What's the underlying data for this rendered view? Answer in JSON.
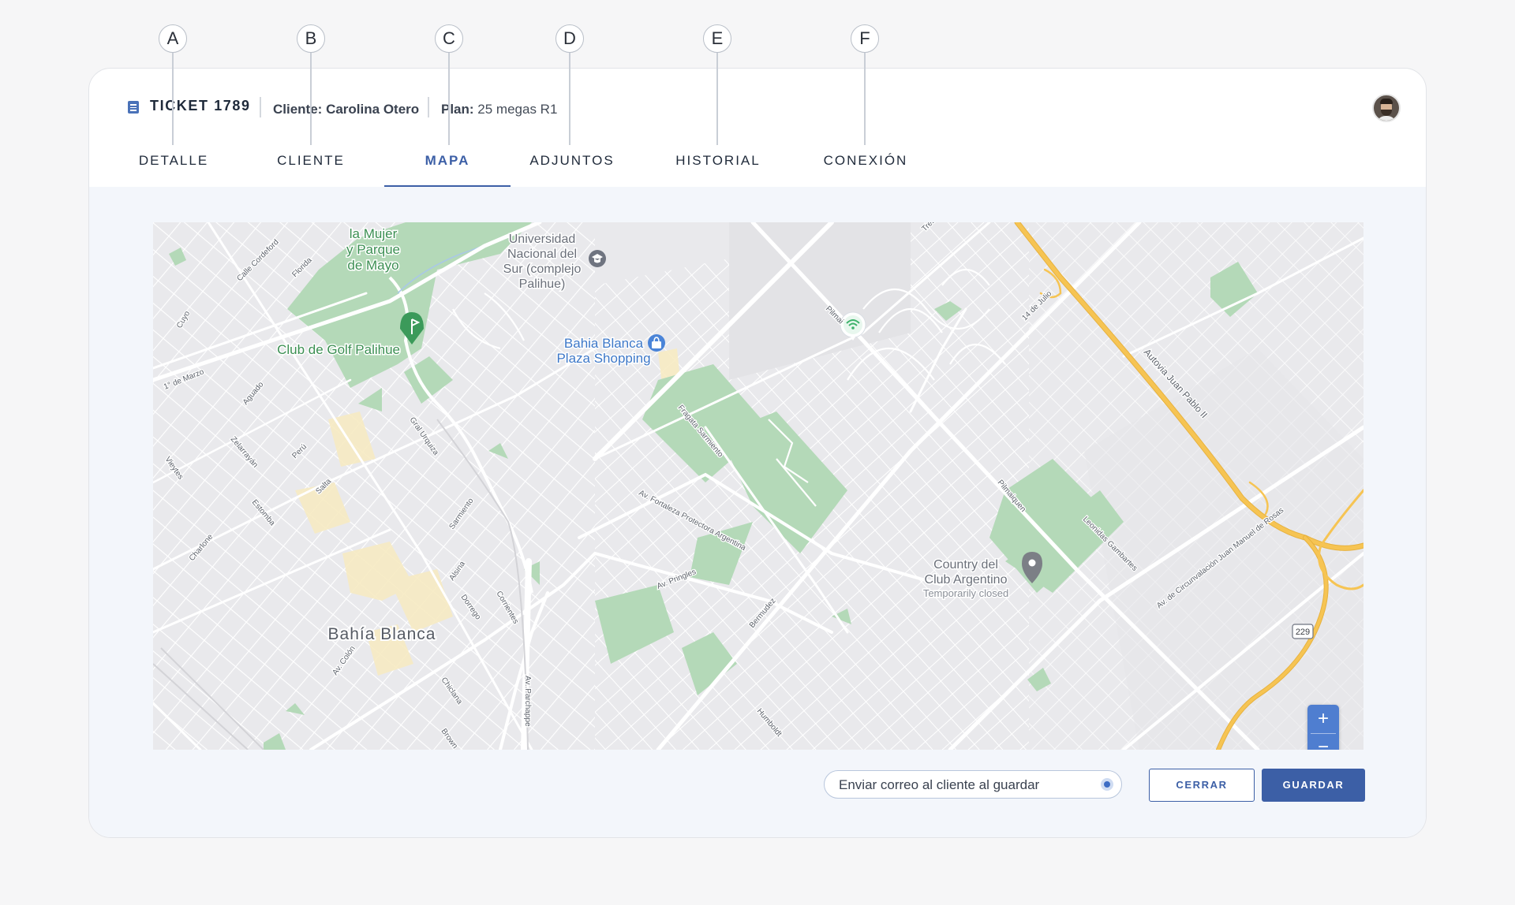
{
  "callouts": [
    "A",
    "B",
    "C",
    "D",
    "E",
    "F"
  ],
  "header": {
    "ticket_title": "TICKET 1789",
    "client_label": "Cliente:",
    "client_value": "Carolina Otero",
    "plan_label": "Plan:",
    "plan_value": "25 megas R1"
  },
  "tabs": [
    {
      "label": "DETALLE"
    },
    {
      "label": "CLIENTE"
    },
    {
      "label": "MAPA",
      "active": true
    },
    {
      "label": "ADJUNTOS"
    },
    {
      "label": "HISTORIAL"
    },
    {
      "label": "CONEXIÓN"
    }
  ],
  "map": {
    "places": {
      "plaza_mayo": [
        "la Mujer",
        "y Parque",
        "de Mayo"
      ],
      "universidad": [
        "Universidad",
        "Nacional del",
        "Sur (complejo",
        "Palihue)"
      ],
      "golf": "Club de Golf Palihue",
      "shopping": [
        "Bahia Blanca",
        "Plaza Shopping"
      ],
      "city": "Bahía Blanca",
      "country": [
        "Country del",
        "Club Argentino"
      ],
      "country_status": "Temporarily closed",
      "route_shield": "229"
    },
    "streets": {
      "calle_cordeford": "Calle Cordeford",
      "florida": "Florida",
      "cuyo": "Cuyo",
      "primero_marzo": "1° de Marzo",
      "aguado": "Aguado",
      "zelarrayan": "Zelarrayán",
      "peru": "Perú",
      "vieytes": "Vieytes",
      "salta": "Salta",
      "estomba": "Estomba",
      "chiclana_upper": "Charlone",
      "uriburu": "Gral Urquiza",
      "sarmiento": "Sarmiento",
      "alsina": "Alsina",
      "dorrego": "Dorrego",
      "corrientes": "Corrientes",
      "colon": "Av. Colón",
      "chiclana": "Chiclana",
      "brown": "Brown",
      "parchappe": "Av. Parchappe",
      "fragata": "Fragata Sarmiento",
      "fortaleza": "Av. Fortaleza Protectora Argentina",
      "pringles": "Av. Pringles",
      "bermudez": "Bermudez",
      "humboldt": "Humboldt",
      "pilmaiquen_top": "Pilmai",
      "pilmaiquen": "Pilmaiquen",
      "tres": "Tres",
      "catorce_julio": "14 de Julio",
      "autovia": "Autovia Juan Pablo II",
      "gambartes": "Leonidas Gambartes",
      "circunvalacion": "Av. de Circunvalación Juan Manuel de Rosas",
      "charlone": "Charlone"
    },
    "zoom_in": "+",
    "zoom_out": "−"
  },
  "footer": {
    "email_toggle_label": "Enviar correo al cliente al guardar",
    "email_toggle_on": true,
    "close_label": "CERRAR",
    "save_label": "GUARDAR"
  },
  "colors": {
    "accent": "#3c5fa6",
    "park": "#b4d9b8",
    "highway": "#f6c453",
    "map_background": "#e9e9ec"
  },
  "icons": {
    "ticket": "document-icon",
    "avatar": "user-avatar",
    "university_pin": "graduation-cap-icon",
    "golf_pin": "golf-icon",
    "shopping_pin": "shopping-bag-icon",
    "wifi_marker": "wifi-icon",
    "country_pin": "location-pin-icon"
  }
}
